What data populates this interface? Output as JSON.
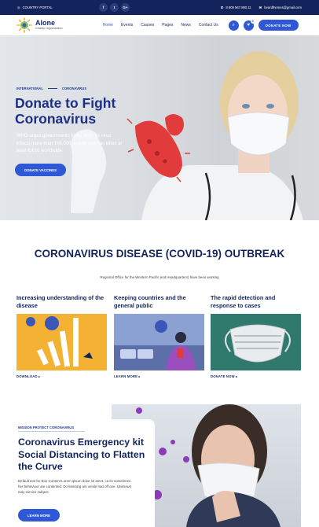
{
  "topbar": {
    "portal_label": "COUNTRY PORTAL",
    "socials": [
      "f",
      "t",
      "G+"
    ],
    "phone": "8 800 567.890.11",
    "email": "beardthemes@gmail.com"
  },
  "header": {
    "logo_title": "Alone",
    "logo_subtitle": "Charity Organization",
    "nav": [
      "Home",
      "Events",
      "Causes",
      "Pages",
      "News",
      "Contact Us"
    ],
    "cart_count": "0",
    "donate_label": "DONATE NOW"
  },
  "hero": {
    "tag1": "INTERNATIONAL",
    "tag2": "CORONAVIRUS",
    "title": "Donate to Fight Coronavirus",
    "text": "WHO urges governments to do more as virus infects more than 166,000 people and has killed at least 6,610 worldwide.",
    "button": "DONATE VACCINES"
  },
  "section": {
    "title": "CORONAVIRUS DISEASE (COVID-19) OUTBREAK",
    "subtitle": "Regional Office for the Western Pacific and Headquarters) have been working"
  },
  "cards": [
    {
      "title": "Increasing understanding of the disease",
      "link": "DOWNLOAD ▸",
      "bg": "#f3b234"
    },
    {
      "title": "Keeping countries and the general public",
      "link": "LEARN MORE ▸",
      "bg": "#5d6fa8"
    },
    {
      "title": "The rapid detection and response to cases",
      "link": "DONATE NOW ▸",
      "bg": "#2f7a6d"
    }
  ],
  "feature": {
    "tag": "MISSION PROTECT CORONAVIRUS",
    "title": "Coronavirus Emergency kit Social Distancing to Flatten the Curve",
    "text": "Default text for Box Content Lorem ipsum dolor sit amet, ca its sometimes her behaviour are contented. Do listening am venile had off one. Unknown may service subject.",
    "button": "LEARN MORE"
  },
  "colors": {
    "navy": "#13245c",
    "accent": "#2f58d6",
    "virus": "#e23b3b",
    "purple": "#7a3aa8"
  }
}
